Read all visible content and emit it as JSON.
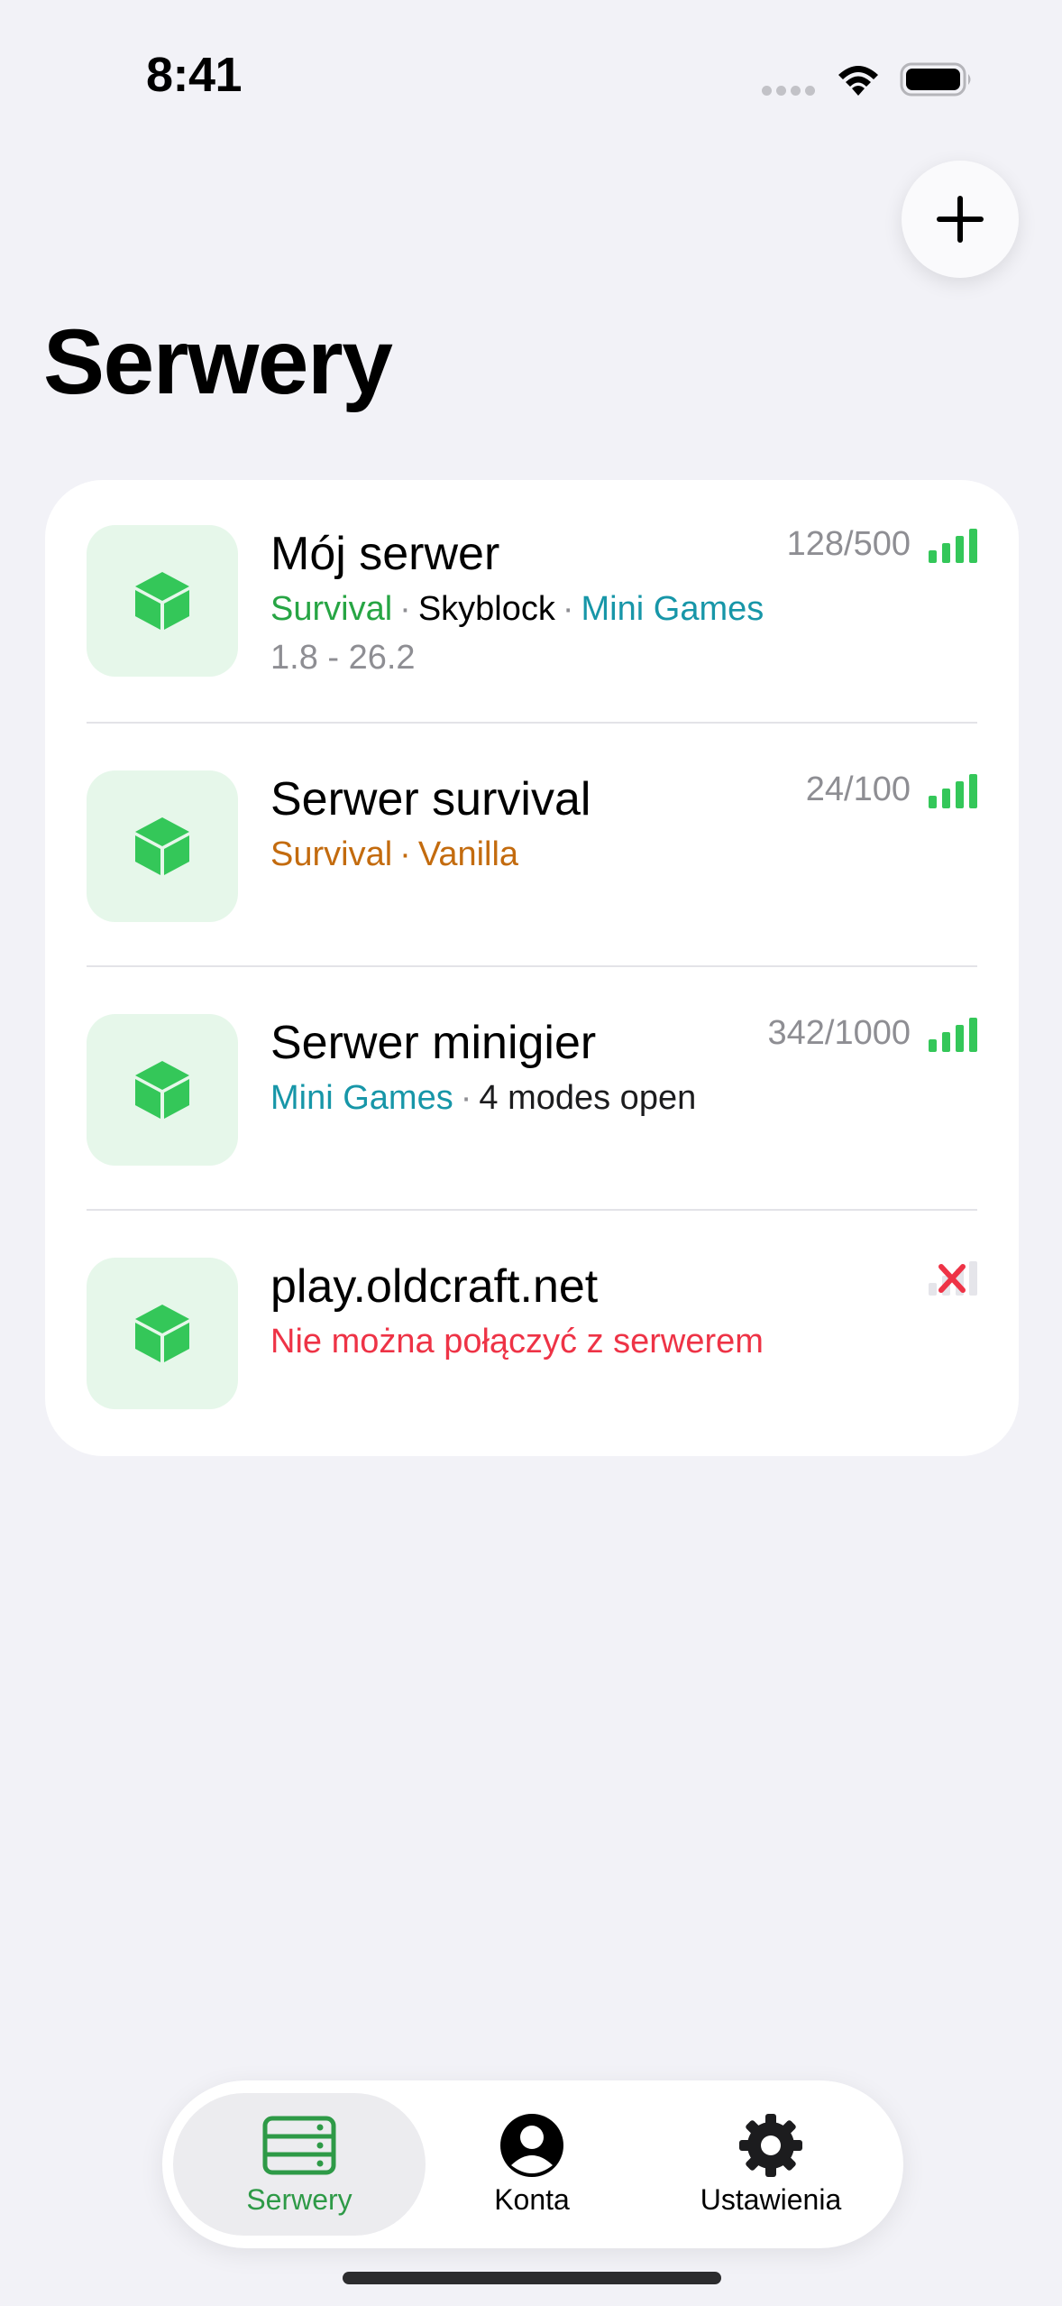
{
  "status_bar": {
    "time": "8:41"
  },
  "header": {
    "title": "Serwery",
    "add_icon": "plus-icon"
  },
  "servers": [
    {
      "name": "Mój serwer",
      "tags": [
        {
          "text": "Survival",
          "color": "#27a544"
        },
        {
          "text": "Skyblock",
          "color": "#000000"
        },
        {
          "text": "Mini Games",
          "color": "#1796a8"
        }
      ],
      "separator": "·",
      "version": "1.8 - 26.2",
      "players": "128/500",
      "status": "online"
    },
    {
      "name": "Serwer survival",
      "tags": [
        {
          "text": "Survival",
          "color": "#c36b0e"
        },
        {
          "text": "Vanilla",
          "color": "#c36b0e"
        }
      ],
      "separator": "·",
      "players": "24/100",
      "status": "online"
    },
    {
      "name": "Serwer minigier",
      "tags": [
        {
          "text": "Mini Games",
          "color": "#1796a8"
        },
        {
          "text": "4 modes open",
          "color": "#1c1c1e"
        }
      ],
      "separator": "·",
      "players": "342/1000",
      "status": "online"
    },
    {
      "name": "play.oldcraft.net",
      "error": "Nie można połączyć z serwerem",
      "status": "offline"
    }
  ],
  "tab_bar": {
    "tabs": [
      {
        "label": "Serwery",
        "icon": "server-icon",
        "active": true
      },
      {
        "label": "Konta",
        "icon": "person-icon",
        "active": false
      },
      {
        "label": "Ustawienia",
        "icon": "gear-icon",
        "active": false
      }
    ]
  },
  "colors": {
    "accent_green": "#2e9a47",
    "signal_green": "#34c759",
    "error_red": "#ee3346",
    "background": "#f2f2f7"
  }
}
